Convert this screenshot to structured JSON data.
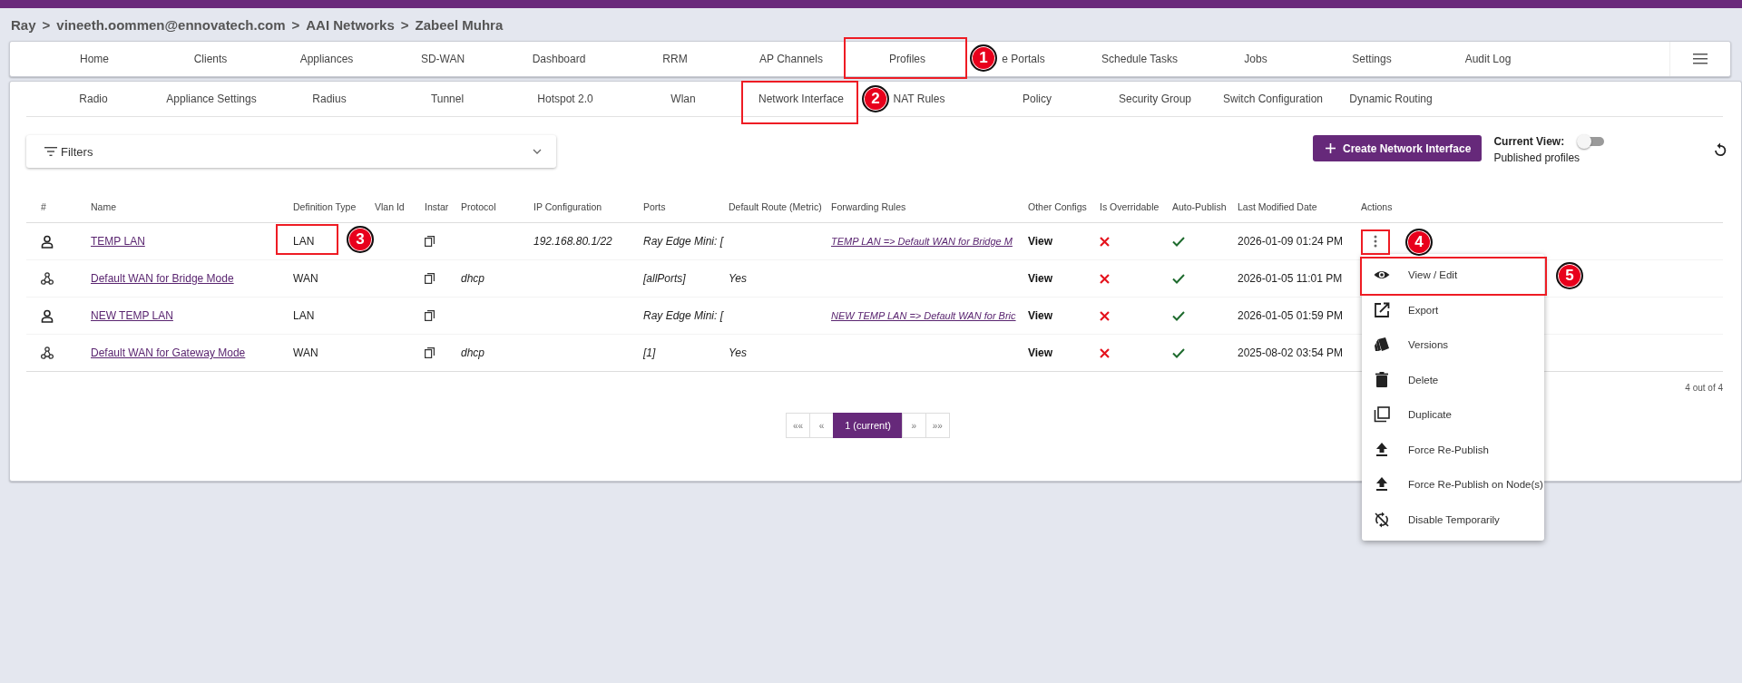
{
  "breadcrumb": [
    "Ray",
    "vineeth.oommen@ennovatech.com",
    "AAI Networks",
    "Zabeel Muhra"
  ],
  "breadcrumb_separator": ">",
  "nav": [
    {
      "label": "Home"
    },
    {
      "label": "Clients"
    },
    {
      "label": "Appliances"
    },
    {
      "label": "SD-WAN"
    },
    {
      "label": "Dashboard"
    },
    {
      "label": "RRM"
    },
    {
      "label": "AP Channels"
    },
    {
      "label": "Profiles",
      "annotation": "1"
    },
    {
      "label": "e Portals"
    },
    {
      "label": "Schedule Tasks"
    },
    {
      "label": "Jobs"
    },
    {
      "label": "Settings"
    },
    {
      "label": "Audit Log"
    }
  ],
  "subtabs": [
    {
      "label": "Radio"
    },
    {
      "label": "Appliance Settings"
    },
    {
      "label": "Radius"
    },
    {
      "label": "Tunnel"
    },
    {
      "label": "Hotspot 2.0"
    },
    {
      "label": "Wlan"
    },
    {
      "label": "Network Interface",
      "annotation": "2"
    },
    {
      "label": "NAT Rules"
    },
    {
      "label": "Policy"
    },
    {
      "label": "Security Group"
    },
    {
      "label": "Switch Configuration"
    },
    {
      "label": "Dynamic Routing"
    }
  ],
  "filters": {
    "label": "Filters"
  },
  "create_button": "Create Network Interface",
  "current_view": {
    "label": "Current View:",
    "value": "Published profiles",
    "on": false
  },
  "table": {
    "columns": [
      "#",
      "Name",
      "Definition Type",
      "Vlan Id",
      "Instar",
      "Protocol",
      "IP Configuration",
      "Ports",
      "Default Route (Metric)",
      "Forwarding Rules",
      "Other Configs",
      "Is Overridable",
      "Auto-Publish",
      "Last Modified Date",
      "Actions"
    ],
    "rows": [
      {
        "kind": "lan",
        "name": "TEMP LAN",
        "type": "LAN",
        "type_annotation": "3",
        "protocol": "",
        "ip": "192.168.80.1/22",
        "ports": "Ray Edge Mini: [",
        "default_route": "",
        "forwarding": "TEMP LAN => Default WAN for Bridge M",
        "other": "View",
        "overridable": false,
        "auto_publish": true,
        "modified": "2026-01-09 01:24 PM",
        "actions_annotation": "4",
        "menu_open": true
      },
      {
        "kind": "wan",
        "name": "Default WAN for Bridge Mode",
        "type": "WAN",
        "protocol": "dhcp",
        "ip": "",
        "ports": "[allPorts]",
        "default_route": "Yes",
        "forwarding": "",
        "other": "View",
        "overridable": false,
        "auto_publish": true,
        "modified": "2026-01-05 11:01 PM",
        "menu_open": false
      },
      {
        "kind": "lan",
        "name": "NEW TEMP LAN",
        "type": "LAN",
        "protocol": "",
        "ip": "",
        "ports": "Ray Edge Mini: [",
        "default_route": "",
        "forwarding": "NEW TEMP LAN => Default WAN for Bric",
        "other": "View",
        "overridable": false,
        "auto_publish": true,
        "modified": "2026-01-05 01:59 PM",
        "menu_open": false
      },
      {
        "kind": "wan",
        "name": "Default WAN for Gateway Mode",
        "type": "WAN",
        "protocol": "dhcp",
        "ip": "",
        "ports": "[1]",
        "default_route": "Yes",
        "forwarding": "",
        "other": "View",
        "overridable": false,
        "auto_publish": true,
        "modified": "2025-08-02 03:54 PM",
        "menu_open": false
      }
    ]
  },
  "count": "4 out of 4",
  "pagination": [
    {
      "label": "««",
      "selected": false
    },
    {
      "label": "«",
      "selected": false
    },
    {
      "label": "1 (current)",
      "selected": true
    },
    {
      "label": "»",
      "selected": false
    },
    {
      "label": "»»",
      "selected": false
    }
  ],
  "menu": [
    {
      "kind": "view",
      "label": "View / Edit",
      "annotation": "5"
    },
    {
      "kind": "export",
      "label": "Export"
    },
    {
      "kind": "versions",
      "label": "Versions"
    },
    {
      "kind": "delete",
      "label": "Delete"
    },
    {
      "kind": "duplicate",
      "label": "Duplicate"
    },
    {
      "kind": "publish",
      "label": "Force Re-Publish"
    },
    {
      "kind": "publish",
      "label": "Force Re-Publish on Node(s)"
    },
    {
      "kind": "disable",
      "label": "Disable Temporarily"
    }
  ]
}
